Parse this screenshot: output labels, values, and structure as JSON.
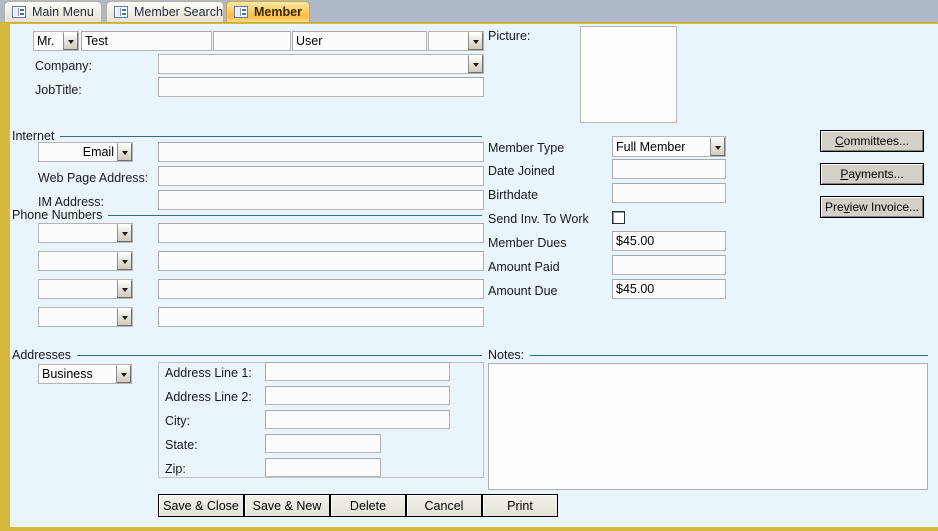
{
  "window": {
    "title": "Member",
    "frame_color": "#d4b93a",
    "form_background": "#e9f4fb",
    "rule_color": "#2e6e86"
  },
  "tabs": [
    {
      "label": "Main Menu",
      "icon": "form-datasheet-icon",
      "active": false
    },
    {
      "label": "Member Search",
      "icon": "form-datasheet-icon",
      "active": false
    },
    {
      "label": "Member",
      "icon": "form-datasheet-icon",
      "active": true
    }
  ],
  "name_row": {
    "title_value": "Mr.",
    "first_name_value": "Test",
    "middle_name_value": "",
    "last_name_value": "User",
    "suffix_value": ""
  },
  "top_fields": {
    "company_label": "Company:",
    "company_value": "",
    "jobtitle_label": "JobTitle:",
    "jobtitle_value": ""
  },
  "picture": {
    "label": "Picture:",
    "value": ""
  },
  "internet": {
    "section_label": "Internet",
    "email_type_value": "Email",
    "email_value": "",
    "webpage_label": "Web Page Address:",
    "webpage_value": "",
    "im_label": "IM Address:",
    "im_value": ""
  },
  "membership": {
    "member_type_label": "Member Type",
    "member_type_value": "Full Member",
    "date_joined_label": "Date Joined",
    "date_joined_value": "",
    "birthdate_label": "Birthdate",
    "birthdate_value": "",
    "send_inv_label": "Send Inv. To Work",
    "send_inv_checked": false,
    "member_dues_label": "Member Dues",
    "member_dues_value": "$45.00",
    "amount_paid_label": "Amount Paid",
    "amount_paid_value": "",
    "amount_due_label": "Amount Due",
    "amount_due_value": "$45.00"
  },
  "side_buttons": [
    {
      "label": "Committees...",
      "accesskey": "C"
    },
    {
      "label": "Payments...",
      "accesskey": "P"
    },
    {
      "label": "Preview Invoice...",
      "accesskey": "v"
    }
  ],
  "phones": {
    "section_label": "Phone Numbers",
    "rows": [
      {
        "type_value": "",
        "number_value": ""
      },
      {
        "type_value": "",
        "number_value": ""
      },
      {
        "type_value": "",
        "number_value": ""
      },
      {
        "type_value": "",
        "number_value": ""
      }
    ]
  },
  "addresses": {
    "section_label": "Addresses",
    "address_type_value": "Business",
    "line1_label": "Address Line 1:",
    "line1_value": "",
    "line2_label": "Address Line 2:",
    "line2_value": "",
    "city_label": "City:",
    "city_value": "",
    "state_label": "State:",
    "state_value": "",
    "zip_label": "Zip:",
    "zip_value": ""
  },
  "notes": {
    "section_label": "Notes:",
    "value": ""
  },
  "footer_buttons": [
    {
      "label": "Save & Close"
    },
    {
      "label": "Save & New"
    },
    {
      "label": "Delete"
    },
    {
      "label": "Cancel"
    },
    {
      "label": "Print"
    }
  ]
}
